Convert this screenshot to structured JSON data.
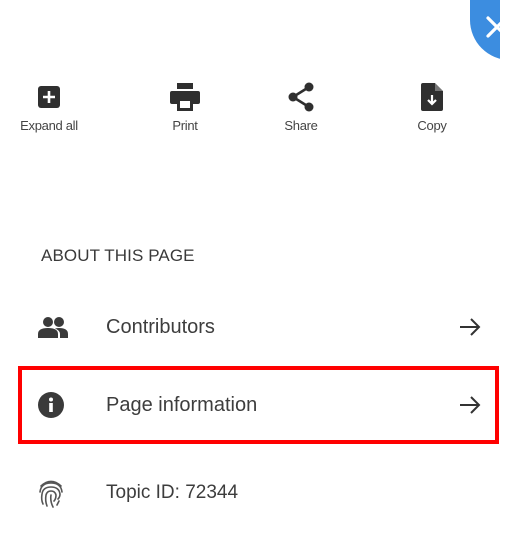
{
  "close": {
    "icon": "close-icon"
  },
  "toolbar": {
    "expand_label": "Expand all",
    "print_label": "Print",
    "share_label": "Share",
    "copy_label": "Copy"
  },
  "section": {
    "title": "ABOUT THIS PAGE"
  },
  "rows": [
    {
      "label": "Contributors",
      "icon": "people-icon",
      "arrow": "arrow-right-icon"
    },
    {
      "label": "Page information",
      "icon": "info-icon",
      "arrow": "arrow-right-icon"
    },
    {
      "label": "Topic ID: 72344",
      "icon": "fingerprint-icon"
    }
  ],
  "colors": {
    "accent": "#3c8de0",
    "highlight": "#ff0000",
    "icon": "#3a3a3a",
    "text": "#3d3d3d"
  }
}
